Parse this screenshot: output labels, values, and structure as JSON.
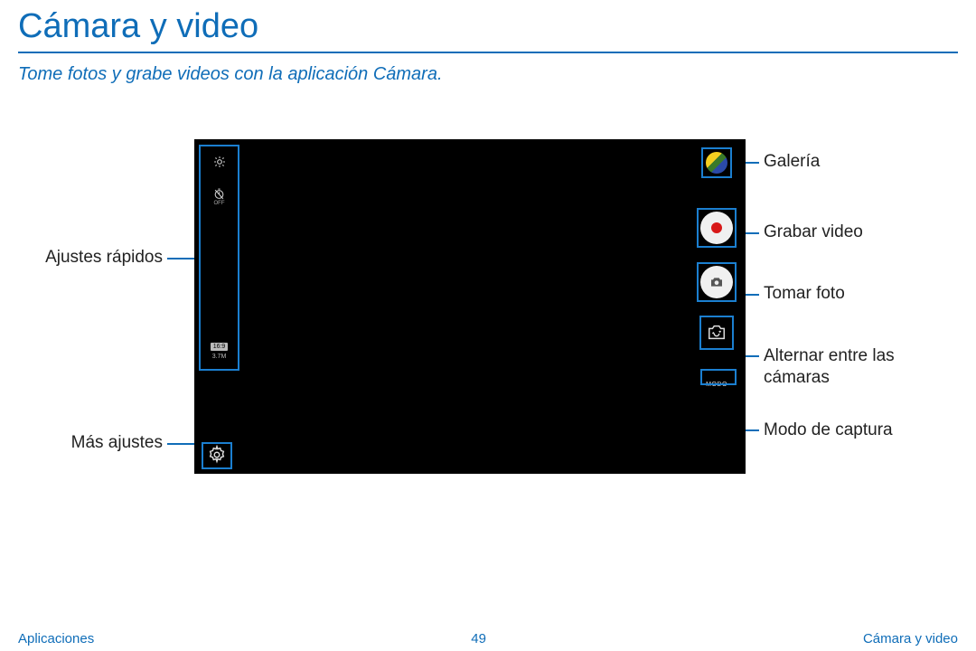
{
  "header": {
    "title": "Cámara y video",
    "subtitle": "Tome fotos y grabe videos con la aplicación Cámara."
  },
  "left_labels": {
    "quick_settings": "Ajustes rápidos",
    "more_settings": "Más ajustes"
  },
  "right_labels": {
    "gallery": "Galería",
    "record": "Grabar video",
    "photo": "Tomar foto",
    "switch": "Alternar entre las cámaras",
    "mode": "Modo de captura"
  },
  "device": {
    "timer_off": "OFF",
    "ratio": "16:9",
    "megapixels": "3.7M",
    "mode_label": "MODO"
  },
  "footer": {
    "left": "Aplicaciones",
    "page": "49",
    "right": "Cámara y video"
  }
}
